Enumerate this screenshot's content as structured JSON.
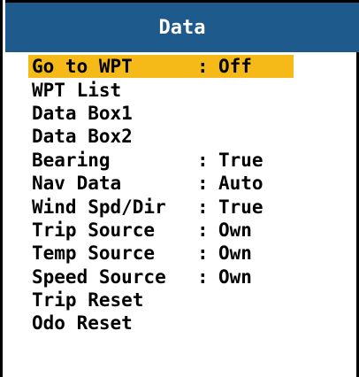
{
  "title": "Data",
  "colors": {
    "titlebar": "#1f5a8c",
    "highlight": "#f5b918",
    "text": "#000000"
  },
  "items": [
    {
      "label": "Go to WPT",
      "sep": ":",
      "value": "Off",
      "selected": true
    },
    {
      "label": "WPT List",
      "sep": "",
      "value": ""
    },
    {
      "label": "Data Box1",
      "sep": "",
      "value": ""
    },
    {
      "label": "Data Box2",
      "sep": "",
      "value": ""
    },
    {
      "label": "Bearing",
      "sep": ":",
      "value": "True"
    },
    {
      "label": "Nav Data",
      "sep": ":",
      "value": "Auto"
    },
    {
      "label": "Wind Spd/Dir",
      "sep": ":",
      "value": "True"
    },
    {
      "label": "Trip Source",
      "sep": ":",
      "value": "Own"
    },
    {
      "label": "Temp Source",
      "sep": ":",
      "value": "Own"
    },
    {
      "label": "Speed Source",
      "sep": ":",
      "value": "Own"
    },
    {
      "label": "Trip Reset",
      "sep": "",
      "value": ""
    },
    {
      "label": "Odo Reset",
      "sep": "",
      "value": ""
    }
  ]
}
